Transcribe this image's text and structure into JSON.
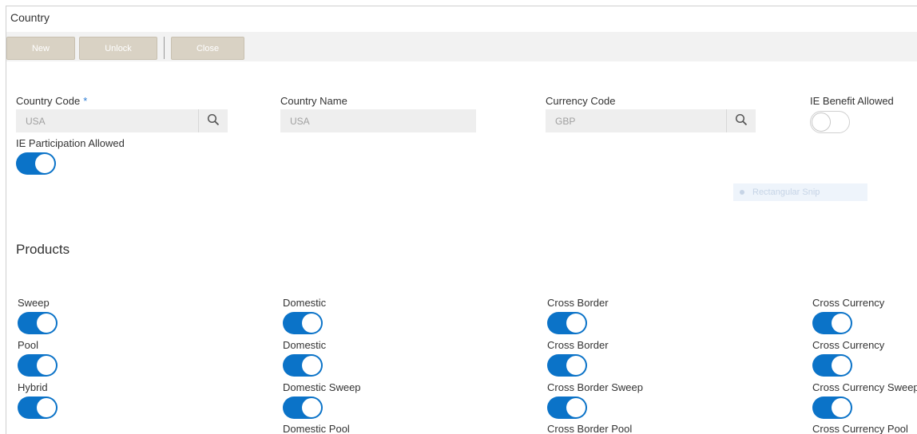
{
  "window": {
    "title": "Country"
  },
  "toolbar": {
    "new_label": "New",
    "unlock_label": "Unlock",
    "close_label": "Close"
  },
  "form": {
    "country_code": {
      "label": "Country Code",
      "required_mark": "*",
      "value": "USA"
    },
    "country_name": {
      "label": "Country Name",
      "value": "USA"
    },
    "currency_code": {
      "label": "Currency Code",
      "value": "GBP"
    },
    "ie_benefit_allowed": {
      "label": "IE Benefit Allowed",
      "checked": false
    },
    "ie_participation_allowed": {
      "label": "IE Participation Allowed",
      "checked": true
    }
  },
  "overlay": {
    "snip_label": "Rectangular Snip"
  },
  "products": {
    "title": "Products",
    "rows": [
      {
        "items": [
          {
            "label": "Sweep",
            "checked": true
          },
          {
            "label": "Domestic",
            "checked": true
          },
          {
            "label": "Cross Border",
            "checked": true
          },
          {
            "label": "Cross Currency",
            "checked": true
          }
        ]
      },
      {
        "items": [
          {
            "label": "Pool",
            "checked": true
          },
          {
            "label": "Domestic",
            "checked": true
          },
          {
            "label": "Cross Border",
            "checked": true
          },
          {
            "label": "Cross Currency",
            "checked": true
          }
        ]
      },
      {
        "items": [
          {
            "label": "Hybrid",
            "checked": true
          },
          {
            "label": "Domestic Sweep",
            "checked": true
          },
          {
            "label": "Cross Border Sweep",
            "checked": true
          },
          {
            "label": "Cross Currency Sweep",
            "checked": true
          }
        ]
      },
      {
        "items": [
          {
            "label": "",
            "checked": null
          },
          {
            "label": "Domestic Pool",
            "checked": null
          },
          {
            "label": "Cross Border Pool",
            "checked": null
          },
          {
            "label": "Cross Currency Pool",
            "checked": null
          }
        ]
      }
    ]
  },
  "colors": {
    "toggle_on": "#0b73c8",
    "button_bg": "#d9d2c4",
    "required_mark": "#2a7bd3"
  }
}
